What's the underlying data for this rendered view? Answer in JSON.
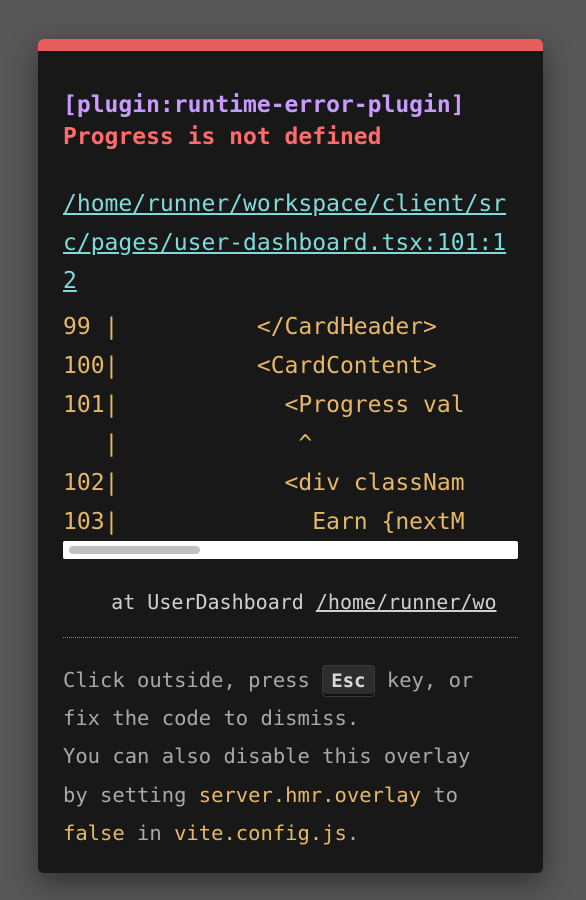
{
  "error": {
    "plugin": "[plugin:runtime-error-plugin]",
    "message": "Progress is not defined",
    "file_link": "/home/runner/workspace/client/src/pages/user-dashboard.tsx:101:12",
    "frame_lines": [
      "99 |          </CardHeader>",
      "100|          <CardContent>",
      "101|            <Progress val",
      "   |             ^",
      "102|            <div classNam",
      "103|              Earn {nextM"
    ],
    "stack_prefix": "    at UserDashboard ",
    "stack_file": "/home/runner/wo"
  },
  "tip": {
    "line1_before": "Click outside, press ",
    "key": "Esc",
    "line1_after": " key, or",
    "line2": "fix the code to dismiss.",
    "line3": "You can also disable this overlay",
    "line4_before": "by setting ",
    "line4_code": "server.hmr.overlay",
    "line4_after": " to",
    "line5_code1": "false",
    "line5_middle": " in ",
    "line5_code2": "vite.config.js",
    "line5_end": "."
  },
  "colors": {
    "top_border": "#e85c5c",
    "plugin": "#c89cff",
    "message": "#ff6b6b",
    "file_link": "#7fdbdb",
    "code_frame": "#e6b768",
    "background": "#181818"
  }
}
